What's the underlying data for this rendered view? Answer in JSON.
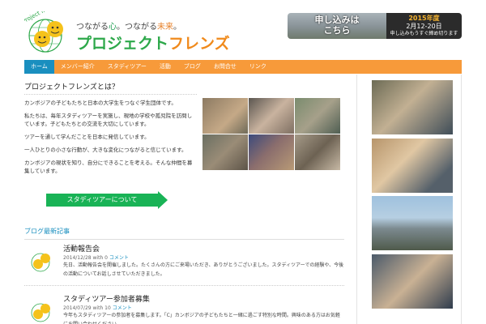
{
  "header": {
    "logo_arc_text": "Project friends",
    "tagline": {
      "part1": "つながる",
      "part2": "心",
      "part3": "。つながる",
      "part4": "未来",
      "part5": "。"
    },
    "brand": {
      "part1": "プロジェクト",
      "part2": "フレンズ"
    },
    "banner": {
      "cta_line1": "申し込みは",
      "cta_line2": "こちら",
      "year": "2015年度",
      "dates": "2月12-20日",
      "deadline": "申し込みもうすぐ締め切ります"
    }
  },
  "nav": {
    "items": [
      {
        "label": "ホーム"
      },
      {
        "label": "メンバー紹介"
      },
      {
        "label": "スタディツアー"
      },
      {
        "label": "活動"
      },
      {
        "label": "ブログ"
      },
      {
        "label": "お問合せ"
      },
      {
        "label": "リンク"
      }
    ]
  },
  "main": {
    "title": "プロジェクトフレンズとは？",
    "paragraphs": [
      "カンボジアの子どもたちと日本の大学生をつなぐ学生団体です。",
      "私たちは、毎年スタディツアーを実施し、現地の学校や孤児院を訪問しています。子どもたちとの交流を大切にしています。",
      "ツアーを通して学んだことを日本に発信しています。",
      "一人ひとりの小さな行動が、大きな変化につながると信じています。",
      "カンボジアの現状を知り、自分にできることを考える。そんな仲間を募集しています。"
    ],
    "study_button": "スタディツアーについて",
    "section_title": "ブログ最新記事",
    "posts": [
      {
        "title": "活動報告会",
        "date": "2014/12/28",
        "with": "with",
        "comments": "0",
        "comments_label": "コメント",
        "excerpt": "先日、活動報告会を開催しました。たくさんの方にご来場いただき、ありがとうございました。スタディツアーでの経験や、今後の活動についてお話しさせていただきました。"
      },
      {
        "title": "スタディツアー参加者募集",
        "date": "2014/07/29",
        "with": "with",
        "comments": "10",
        "comments_label": "コメント",
        "excerpt": "今年もスタディツアーの参加者を募集します。「C」カンボジアの子どもたちと一緒に過ごす特別な時間。興味のある方はお気軽にお問い合わせください。"
      }
    ]
  },
  "colors": {
    "nav_bg": "#f79a3a",
    "nav_active": "#1a8fbf",
    "cta_green": "#19b356",
    "link_blue": "#1a8fbf"
  }
}
